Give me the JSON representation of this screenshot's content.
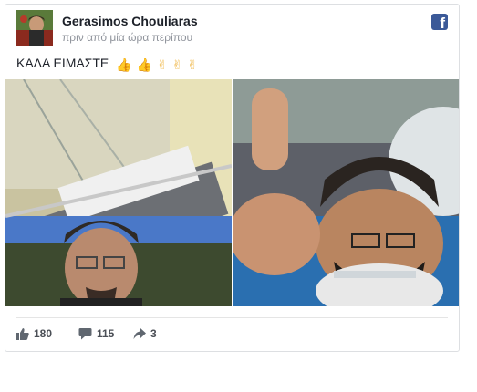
{
  "post": {
    "author": "Gerasimos Chouliaras",
    "timestamp": "πριν από μία ώρα περίπου",
    "text": "ΚΑΛΑ ΕΙΜΑΣΤΕ",
    "emojis": [
      "👍",
      "👍",
      "✌",
      "✌",
      "✌"
    ],
    "platform_icon": "facebook-icon",
    "brand_color": "#3b5998"
  },
  "photos": [
    {
      "icon": "photo-hospital-selfie",
      "alt_role": "left"
    },
    {
      "icon": "photo-thumbs-up-selfie",
      "alt_role": "right"
    }
  ],
  "stats": {
    "likes": "180",
    "comments": "115",
    "shares": "3"
  }
}
